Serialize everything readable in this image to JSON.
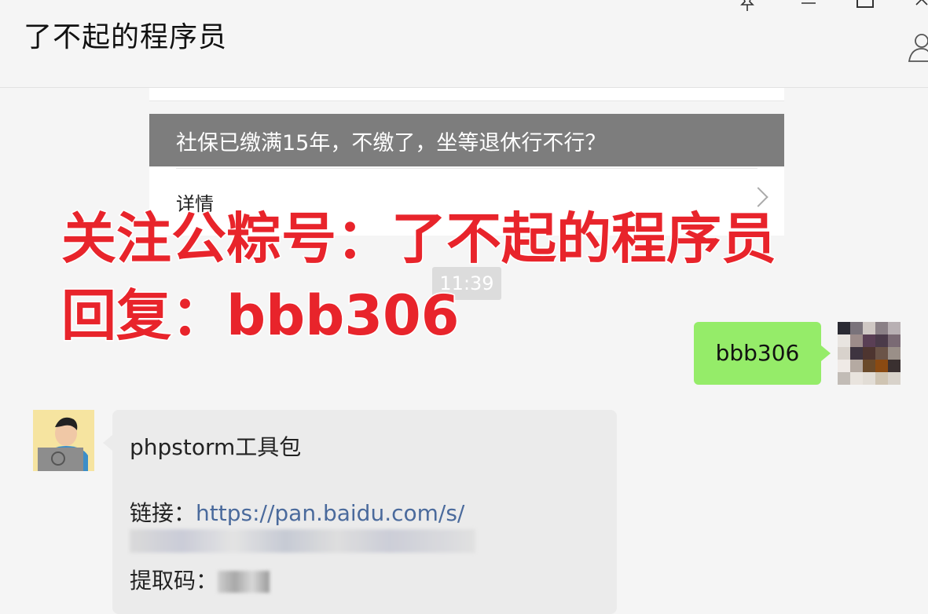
{
  "window": {
    "title": "了不起的程序员",
    "pin_icon": "pin-icon",
    "minimize_icon": "minimize-icon",
    "maximize_icon": "maximize-icon",
    "close_icon": "close-icon",
    "person_icon": "person-icon"
  },
  "article_card": {
    "headline": "社保已缴满15年，不缴了，坐等退休行不行？",
    "details_label": "详情",
    "chevron_icon": "chevron-right-icon"
  },
  "timestamp": "11:39",
  "overlay": {
    "line1": "关注公粽号：了不起的程序员",
    "line2": "回复：bbb306",
    "color": "#e8242b"
  },
  "sent_message": {
    "text": "bbb306",
    "bubble_color": "#95ec69"
  },
  "received_message": {
    "title": "phpstorm工具包",
    "link_label": "链接：",
    "link_url": "https://pan.baidu.com/s/",
    "code_label": "提取码："
  }
}
